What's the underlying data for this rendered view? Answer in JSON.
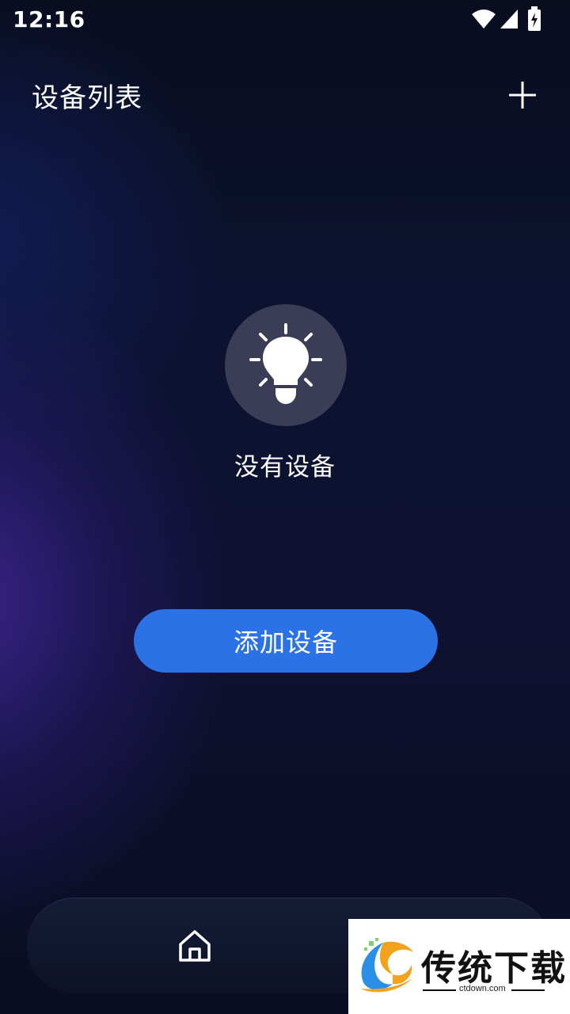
{
  "status_bar": {
    "time": "12:16",
    "icons": [
      "wifi-icon",
      "signal-icon",
      "battery-charging-icon"
    ]
  },
  "header": {
    "title": "设备列表",
    "add_icon": "plus-icon"
  },
  "empty_state": {
    "icon": "lightbulb-icon",
    "message": "没有设备"
  },
  "actions": {
    "add_device_label": "添加设备"
  },
  "bottom_nav": {
    "items": [
      {
        "icon": "home-icon"
      }
    ]
  },
  "watermark": {
    "title": "传统下载",
    "subtitle": "ctdown.com"
  },
  "colors": {
    "primary_button": "#2a72e6",
    "background": "#0a0e22",
    "icon_circle": "#3a3d55"
  }
}
